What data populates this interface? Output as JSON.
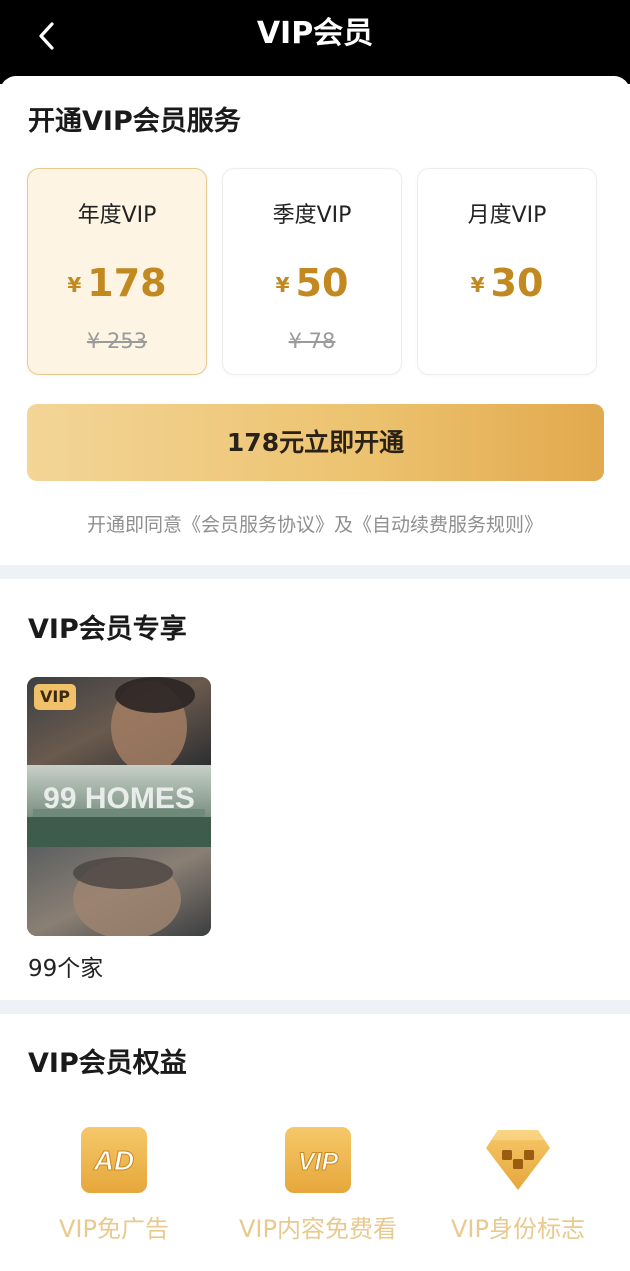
{
  "header": {
    "title": "VIP会员",
    "back_icon": "chevron-left-icon"
  },
  "subscribe": {
    "title": "开通VIP会员服务",
    "plans": [
      {
        "name": "年度VIP",
        "currency": "¥",
        "price": "178",
        "original": "¥ 253",
        "selected": true
      },
      {
        "name": "季度VIP",
        "currency": "¥",
        "price": "50",
        "original": "¥ 78",
        "selected": false
      },
      {
        "name": "月度VIP",
        "currency": "¥",
        "price": "30",
        "original": "",
        "selected": false
      }
    ],
    "cta_label": "178元立即开通",
    "agreement_prefix": "开通即同意",
    "agreement_link1": "《会员服务协议》",
    "agreement_mid": "及",
    "agreement_link2": "《自动续费服务规则》"
  },
  "exclusive": {
    "title": "VIP会员专享",
    "items": [
      {
        "badge": "VIP",
        "poster_text": "99 HOMES",
        "caption": "99个家"
      }
    ]
  },
  "benefits": {
    "title": "VIP会员权益",
    "items": [
      {
        "label": "VIP免广告",
        "icon": "ad-free-icon",
        "glyph": "AD"
      },
      {
        "label": "VIP内容免费看",
        "icon": "vip-content-icon",
        "glyph": "VIP"
      },
      {
        "label": "VIP身份标志",
        "icon": "vip-badge-icon",
        "glyph": ""
      }
    ]
  },
  "colors": {
    "accent_gold": "#c1891f",
    "cta_gradient_start": "#f3d597",
    "cta_gradient_end": "#e2a94d",
    "benefit_label": "#e9c98e"
  }
}
